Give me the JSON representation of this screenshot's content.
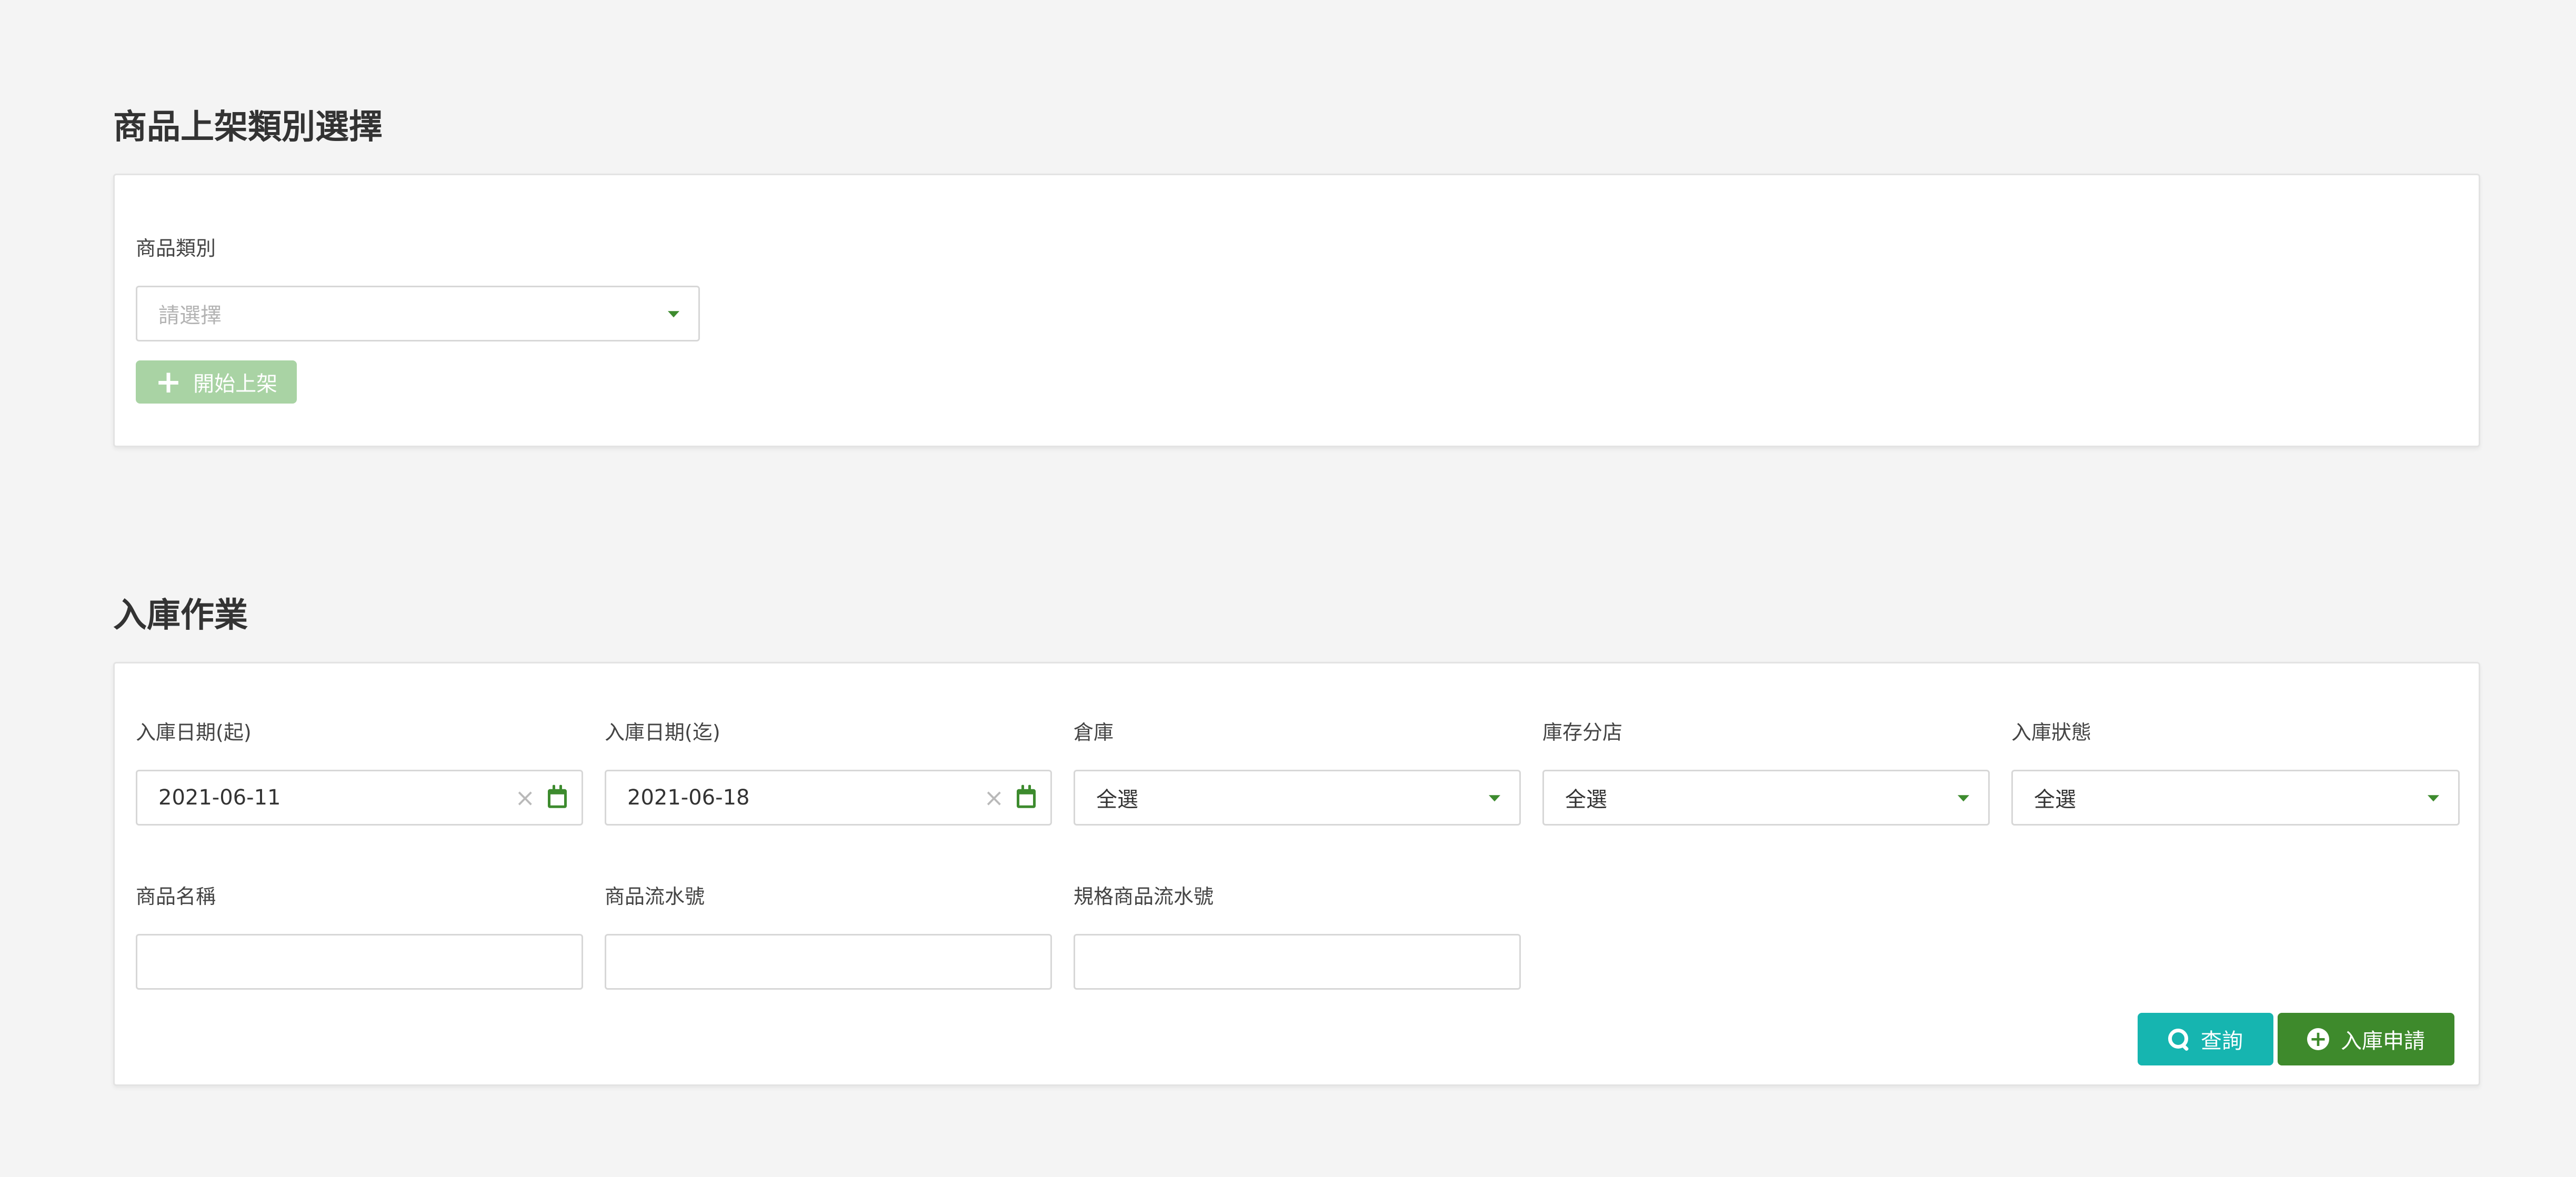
{
  "listing_section": {
    "title": "商品上架類別選擇",
    "category_label": "商品類別",
    "category_placeholder": "請選擇",
    "start_button_label": "開始上架"
  },
  "inbound_section": {
    "title": "入庫作業",
    "date_start": {
      "label": "入庫日期(起)",
      "value": "2021-06-11"
    },
    "date_end": {
      "label": "入庫日期(迄)",
      "value": "2021-06-18"
    },
    "warehouse": {
      "label": "倉庫",
      "value": "全選"
    },
    "inventory_branch": {
      "label": "庫存分店",
      "value": "全選"
    },
    "inbound_status": {
      "label": "入庫狀態",
      "value": "全選"
    },
    "product_name": {
      "label": "商品名稱",
      "value": ""
    },
    "product_serial": {
      "label": "商品流水號",
      "value": ""
    },
    "spec_product_serial": {
      "label": "規格商品流水號",
      "value": ""
    },
    "search_button_label": "查詢",
    "apply_button_label": "入庫申請"
  },
  "colors": {
    "accent_green": "#3e8a2c",
    "disabled_green": "#a9d3a4",
    "search_teal": "#16b5b0",
    "background": "#f4f4f4"
  },
  "icons": {
    "start_button": "plus-icon",
    "search_button": "search-icon",
    "apply_button": "plus-circle-icon",
    "date_clear": "clear-icon",
    "date_picker": "calendar-icon",
    "select": "chevron-down-icon"
  }
}
